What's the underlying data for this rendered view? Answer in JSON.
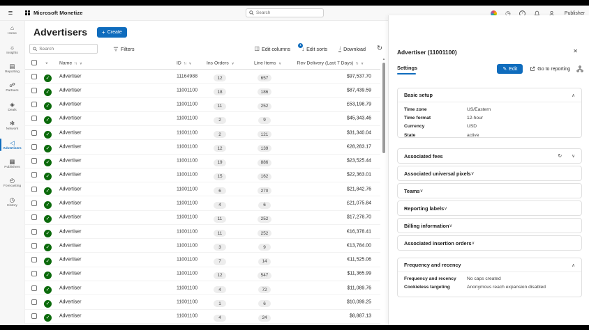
{
  "topbar": {
    "app_name": "Microsoft Monetize",
    "search_placeholder": "Search",
    "user_label": "Publisher"
  },
  "sidebar": {
    "items": [
      {
        "label": "Home",
        "icon": "home",
        "active": false
      },
      {
        "label": "Insights",
        "icon": "insights",
        "active": false
      },
      {
        "label": "Reporting",
        "icon": "reporting",
        "active": false
      },
      {
        "label": "Partners",
        "icon": "partners",
        "active": false
      },
      {
        "label": "Deals",
        "icon": "deals",
        "active": false
      },
      {
        "label": "Network",
        "icon": "network",
        "active": false
      },
      {
        "label": "Advertisers",
        "icon": "advertisers",
        "active": true
      },
      {
        "label": "Publishers",
        "icon": "publishers",
        "active": false
      },
      {
        "label": "Forecasting",
        "icon": "forecasting",
        "active": false
      },
      {
        "label": "History",
        "icon": "history",
        "active": false
      }
    ]
  },
  "page": {
    "title": "Advertisers",
    "create_label": "Create"
  },
  "toolbar": {
    "search_placeholder": "Search",
    "filters_label": "Filters",
    "edit_columns_label": "Edit columns",
    "edit_sorts_label": "Edit sorts",
    "edit_sorts_badge": "1",
    "download_label": "Download"
  },
  "table": {
    "columns": {
      "name": "Name",
      "id": "ID",
      "ins_orders": "Ins Orders",
      "line_items": "Line Items",
      "rev": "Rev Delivery (Last 7 Days)"
    },
    "rows": [
      {
        "name": "Advertiser",
        "id": "11164988",
        "ins": "12",
        "line": "657",
        "rev": "$97,537.70"
      },
      {
        "name": "Advertiser",
        "id": "11001100",
        "ins": "18",
        "line": "186",
        "rev": "$87,439.59"
      },
      {
        "name": "Advertiser",
        "id": "11001100",
        "ins": "11",
        "line": "252",
        "rev": "£53,198.79"
      },
      {
        "name": "Advertiser",
        "id": "11001100",
        "ins": "2",
        "line": "9",
        "rev": "$45,343.46"
      },
      {
        "name": "Advertiser",
        "id": "11001100",
        "ins": "2",
        "line": "121",
        "rev": "$31,340.04"
      },
      {
        "name": "Advertiser",
        "id": "11001100",
        "ins": "12",
        "line": "139",
        "rev": "€28,283.17"
      },
      {
        "name": "Advertiser",
        "id": "11001100",
        "ins": "19",
        "line": "886",
        "rev": "$23,525.44"
      },
      {
        "name": "Advertiser",
        "id": "11001100",
        "ins": "15",
        "line": "162",
        "rev": "$22,363.01"
      },
      {
        "name": "Advertiser",
        "id": "11001100",
        "ins": "6",
        "line": "270",
        "rev": "$21,842.76"
      },
      {
        "name": "Advertiser",
        "id": "11001100",
        "ins": "4",
        "line": "6",
        "rev": "£21,075.84"
      },
      {
        "name": "Advertiser",
        "id": "11001100",
        "ins": "11",
        "line": "252",
        "rev": "$17,278.70"
      },
      {
        "name": "Advertiser",
        "id": "11001100",
        "ins": "11",
        "line": "252",
        "rev": "€16,378.41"
      },
      {
        "name": "Advertiser",
        "id": "11001100",
        "ins": "3",
        "line": "9",
        "rev": "€13,784.00"
      },
      {
        "name": "Advertiser",
        "id": "11001100",
        "ins": "7",
        "line": "14",
        "rev": "€11,525.06"
      },
      {
        "name": "Advertiser",
        "id": "11001100",
        "ins": "12",
        "line": "547",
        "rev": "$11,365.99"
      },
      {
        "name": "Advertiser",
        "id": "11001100",
        "ins": "4",
        "line": "72",
        "rev": "$11,089.76"
      },
      {
        "name": "Advertiser",
        "id": "11001100",
        "ins": "1",
        "line": "6",
        "rev": "$10,099.25"
      },
      {
        "name": "Advertiser",
        "id": "11001100",
        "ins": "4",
        "line": "24",
        "rev": "$8,887.13"
      }
    ]
  },
  "panel": {
    "title": "Advertiser (11001100)",
    "tab_label": "Settings",
    "edit_label": "Edit",
    "goto_label": "Go to reporting",
    "basic_setup": {
      "title": "Basic setup",
      "fields": [
        {
          "label": "Time zone",
          "value": "US/Eastern"
        },
        {
          "label": "Time format",
          "value": "12-hour"
        },
        {
          "label": "Currency",
          "value": "USD"
        },
        {
          "label": "State",
          "value": "active"
        }
      ]
    },
    "accordions": [
      {
        "label": "Associated fees",
        "refresh": true
      },
      {
        "label": "Associated universal pixels",
        "refresh": false
      },
      {
        "label": "Teams",
        "refresh": false
      },
      {
        "label": "Reporting labels",
        "refresh": false
      },
      {
        "label": "Billing information",
        "refresh": false
      },
      {
        "label": "Associated insertion orders",
        "refresh": false
      }
    ],
    "frequency": {
      "title": "Frequency and recency",
      "fields": [
        {
          "label": "Frequency and recency",
          "value": "No caps created"
        },
        {
          "label": "Cookieless targeting",
          "value": "Anonymous reach expansion disabled"
        }
      ]
    }
  },
  "colors": {
    "accent": "#0f6cbd",
    "status_green": "#0b6a0b"
  }
}
